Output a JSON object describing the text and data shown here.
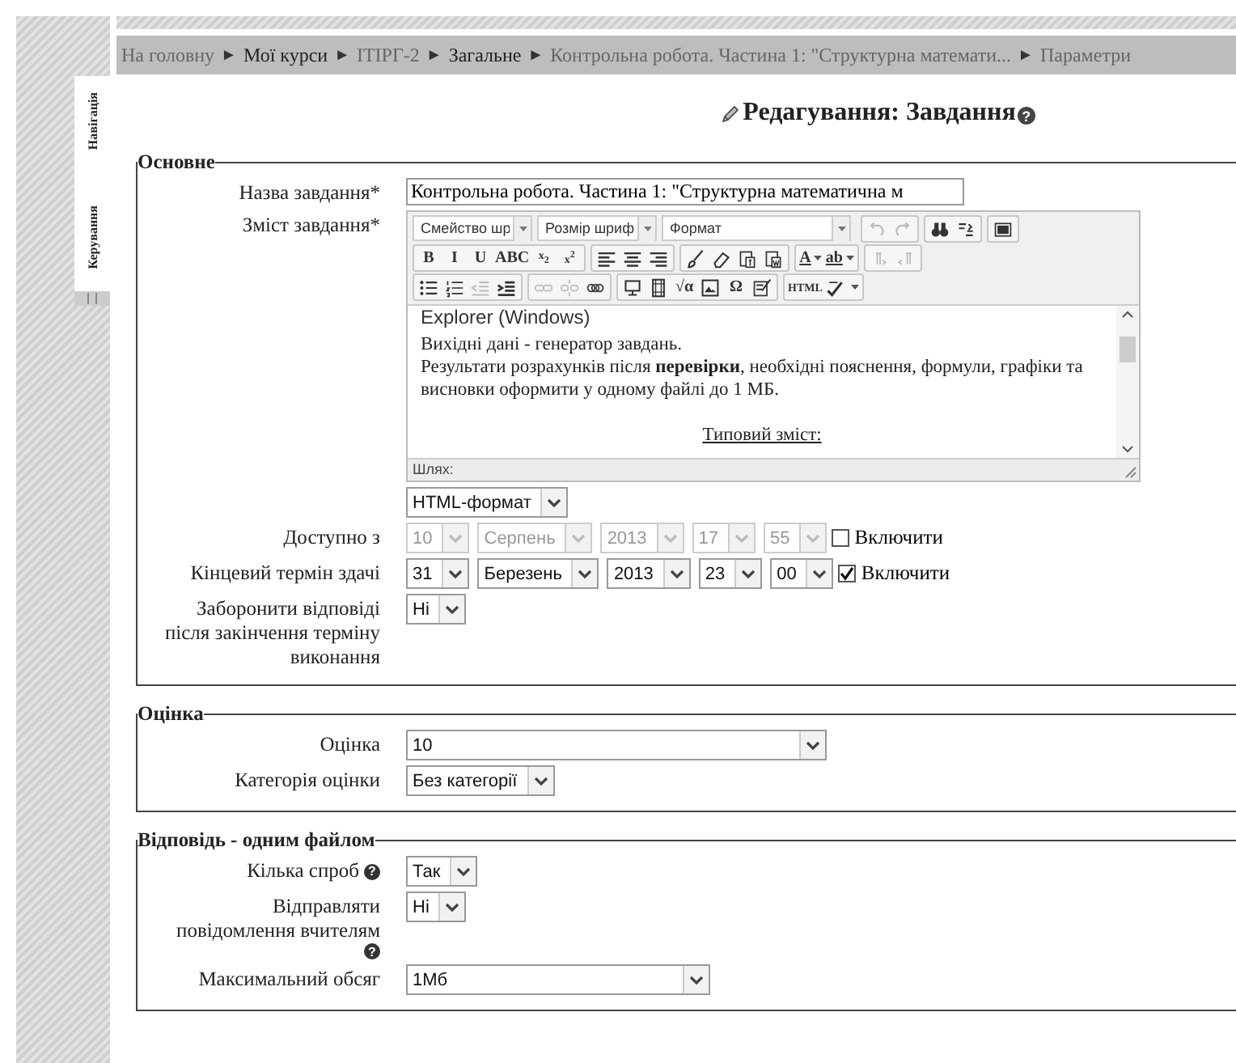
{
  "sidebar": {
    "tabs": [
      {
        "label": "Навігація"
      },
      {
        "label": "Керування"
      }
    ]
  },
  "breadcrumb": [
    {
      "label": "На головну",
      "muted": true
    },
    {
      "separator": "►",
      "label": "Мої курси",
      "muted": false
    },
    {
      "separator": "►",
      "label": "ІТІРГ-2",
      "muted": true
    },
    {
      "separator": "►",
      "label": "Загальне",
      "muted": false
    },
    {
      "separator": "►",
      "label": "Контрольна робота. Частина 1: \"Структурна математи...",
      "muted": true
    },
    {
      "separator": "►",
      "label": "Параметри",
      "muted": true
    }
  ],
  "title": "Редагування: Завдання",
  "title_help": "?",
  "sections": [
    {
      "legend": "Основне",
      "rows": [
        {
          "kind": "text",
          "label": "Назва завдання*",
          "value": "Контрольна робота. Частина 1: \"Структурна математична м"
        },
        {
          "kind": "editor",
          "label": "Зміст завдання*",
          "toolbar": [
            [
              [
                {
                  "kind": "dropdown",
                  "label": "Смейство шр"
                },
                {
                  "kind": "dropdown",
                  "label": "Розмір шриф"
                },
                {
                  "kind": "dropdown",
                  "label": "Формат"
                }
              ],
              [
                {
                  "kind": "icon",
                  "disabled": true
                },
                {
                  "kind": "icon",
                  "disabled": true
                }
              ],
              [
                {
                  "kind": "icon",
                  "disabled": false
                },
                {
                  "kind": "icon",
                  "disabled": false
                }
              ],
              [
                {
                  "kind": "icon",
                  "disabled": false
                }
              ]
            ],
            [
              [
                {
                  "kind": "glyph",
                  "label": "B",
                  "disabled": false
                },
                {
                  "kind": "glyph",
                  "label": "I",
                  "disabled": false
                },
                {
                  "kind": "glyph",
                  "label": "U",
                  "disabled": false
                },
                {
                  "kind": "glyph",
                  "label": "ABC",
                  "disabled": false
                },
                {
                  "kind": "glyph",
                  "label": "x$_{2}$",
                  "disabled": false
                },
                {
                  "kind": "glyph",
                  "label": "x$^{2}$",
                  "disabled": false
                }
              ],
              [
                {
                  "kind": "icon",
                  "disabled": false
                },
                {
                  "kind": "icon",
                  "disabled": false
                },
                {
                  "kind": "icon",
                  "disabled": false
                }
              ],
              [
                {
                  "kind": "icon",
                  "disabled": false
                },
                {
                  "kind": "icon",
                  "disabled": false
                },
                {
                  "kind": "icon",
                  "disabled": false
                },
                {
                  "kind": "icon",
                  "disabled": false
                }
              ],
              [
                {
                  "kind": "split-glyph",
                  "label": "A",
                  "disabled": false
                },
                {
                  "kind": "split-glyph",
                  "label": "ab",
                  "disabled": false
                }
              ],
              [
                {
                  "kind": "icon",
                  "disabled": true
                },
                {
                  "kind": "icon",
                  "disabled": true
                }
              ]
            ],
            [
              [
                {
                  "kind": "icon",
                  "disabled": false
                },
                {
                  "kind": "icon",
                  "disabled": false
                },
                {
                  "kind": "icon",
                  "disabled": true
                },
                {
                  "kind": "icon",
                  "disabled": false
                }
              ],
              [
                {
                  "kind": "icon",
                  "disabled": true
                },
                {
                  "kind": "icon",
                  "disabled": true
                },
                {
                  "kind": "icon",
                  "disabled": false
                }
              ],
              [
                {
                  "kind": "icon",
                  "disabled": false
                },
                {
                  "kind": "icon",
                  "disabled": false
                },
                {
                  "kind": "glyph",
                  "label": "√α",
                  "disabled": false
                },
                {
                  "kind": "icon",
                  "disabled": false
                },
                {
                  "kind": "glyph",
                  "label": "Ω",
                  "disabled": false
                },
                {
                  "kind": "icon",
                  "disabled": false
                }
              ],
              [
                {
                  "kind": "glyph",
                  "label": "HTML",
                  "disabled": false
                },
                {
                  "kind": "split-icon",
                  "disabled": false
                }
              ]
            ]
          ],
          "content": [
            {
              "kind": "heading",
              "text": "Explorer (Windows)"
            },
            {
              "kind": "paragraph",
              "text": "Вихідні дані - генератор завдань."
            },
            {
              "kind": "paragraph",
              "text": "Результати розрахунків після **перевірки**, необхідні пояснення, формули, графіки та висновки оформити у одному файлі до 1 МБ."
            },
            {
              "kind": "link",
              "text": "Типовий зміст:"
            }
          ],
          "path_label": "Шлях:",
          "format": "HTML-формат"
        },
        {
          "kind": "datetime",
          "label": "Доступно з",
          "disabled": true,
          "fields": [
            "10",
            "Серпень",
            "2013",
            "17",
            "55"
          ],
          "checkbox": {
            "label": "Включити",
            "checked": false
          }
        },
        {
          "kind": "datetime",
          "label": "Кінцевий термін здачі",
          "disabled": false,
          "fields": [
            "31",
            "Березень",
            "2013",
            "23",
            "00"
          ],
          "checkbox": {
            "label": "Включити",
            "checked": true
          }
        },
        {
          "kind": "select",
          "label": "Заборонити відповіді після закінчення терміну виконання",
          "value": "Ні"
        }
      ]
    },
    {
      "legend": "Оцінка",
      "rows": [
        {
          "kind": "select",
          "label": "Оцінка",
          "value": "10"
        },
        {
          "kind": "select",
          "label": "Категорія оцінки",
          "value": "Без категорії"
        }
      ]
    },
    {
      "legend": "Відповідь - одним файлом",
      "rows": [
        {
          "kind": "select",
          "label": "Кілька спроб",
          "help": "?",
          "value": "Так"
        },
        {
          "kind": "select",
          "label": "Відправляти повідомлення вчителям",
          "help": "?",
          "value": "Ні"
        },
        {
          "kind": "select",
          "label": "Максимальний обсяг",
          "value": "1Мб"
        }
      ]
    }
  ]
}
